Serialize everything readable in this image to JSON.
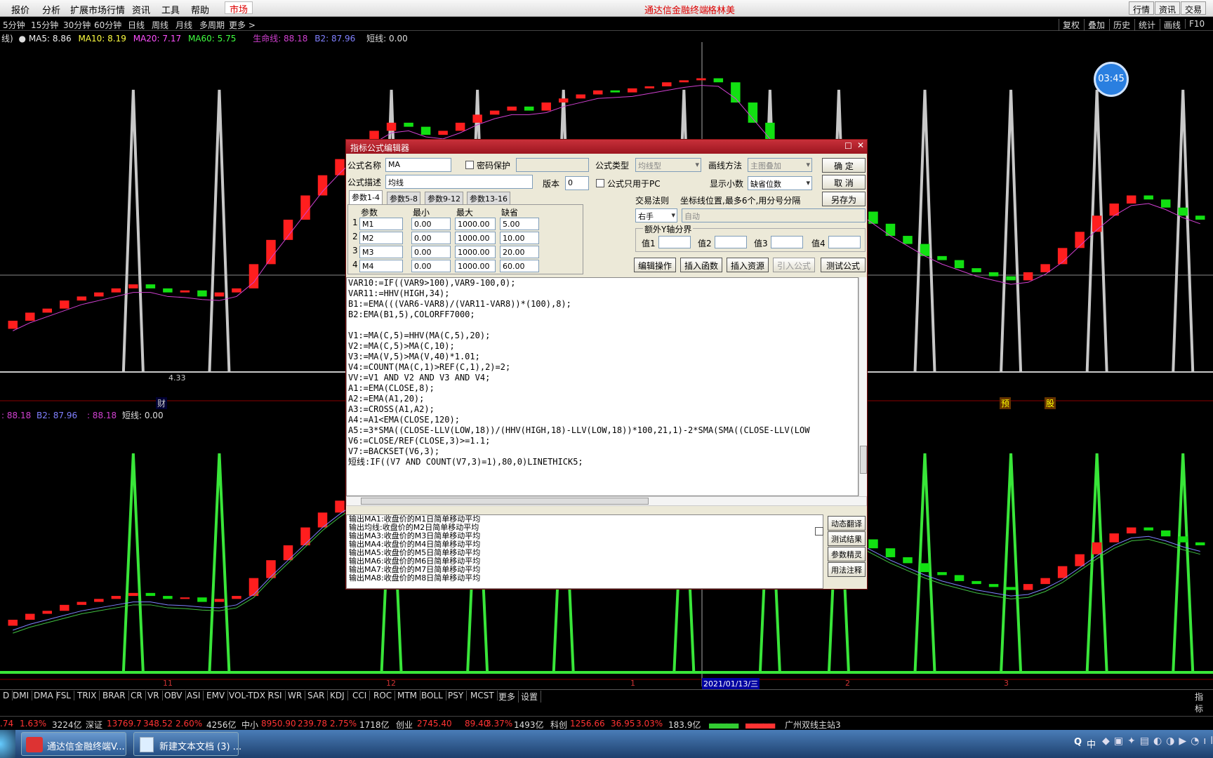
{
  "menu": {
    "items": [
      "报价",
      "分析",
      "扩展市场行情",
      "资讯",
      "工具",
      "帮助"
    ],
    "market_tab": "市场",
    "title": "通达信金融终端",
    "user": "格林美",
    "right_buttons": [
      "行情",
      "资讯",
      "交易"
    ]
  },
  "periods": {
    "items": [
      "5分钟",
      "15分钟",
      "30分钟",
      "60分钟",
      "日线",
      "周线",
      "月线",
      "多周期",
      "更多 >"
    ],
    "right": [
      "复权",
      "叠加",
      "历史",
      "统计",
      "画线",
      "F10"
    ]
  },
  "upper_legend": {
    "prefix": "线)",
    "ma5": "MA5: 8.86",
    "ma10": "MA10: 8.19",
    "ma20": "MA20: 7.17",
    "ma60": "MA60: 5.75",
    "life": "生命线: 88.18",
    "b2": "B2: 87.96",
    "short": "短线: 0.00"
  },
  "lower_legend": {
    "a": ": 88.18",
    "b2": "B2: 87.96",
    "c": ": 88.18",
    "short": "短线: 0.00"
  },
  "marks": {
    "cai": "财",
    "yu": "预",
    "gu": "股",
    "lowlabel": "4.33"
  },
  "timer": "03:45",
  "dialog": {
    "title": "指标公式编辑器",
    "name_label": "公式名称",
    "name_value": "MA",
    "password_label": "密码保护",
    "type_label": "公式类型",
    "type_value": "均线型",
    "draw_label": "画线方法",
    "draw_value": "主图叠加",
    "ok": "确 定",
    "cancel": "取 消",
    "saveas": "另存为",
    "desc_label": "公式描述",
    "desc_value": "均线",
    "version_label": "版本",
    "version_value": "0",
    "pc_only": "公式只用于PC",
    "decimals_label": "显示小数",
    "decimals_value": "缺省位数",
    "tabs": [
      "参数1-4",
      "参数5-8",
      "参数9-12",
      "参数13-16"
    ],
    "param_headers": [
      "参数",
      "最小",
      "最大",
      "缺省"
    ],
    "params": [
      {
        "n": "1",
        "name": "M1",
        "min": "0.00",
        "max": "1000.00",
        "def": "5.00"
      },
      {
        "n": "2",
        "name": "M2",
        "min": "0.00",
        "max": "1000.00",
        "def": "10.00"
      },
      {
        "n": "3",
        "name": "M3",
        "min": "0.00",
        "max": "1000.00",
        "def": "20.00"
      },
      {
        "n": "4",
        "name": "M4",
        "min": "0.00",
        "max": "1000.00",
        "def": "60.00"
      }
    ],
    "trade_label": "交易法则",
    "coord_label": "坐标线位置,最多6个,用分号分隔",
    "hand_value": "右手",
    "auto_value": "自动",
    "yaxis_label": "额外Y轴分界",
    "val_labels": [
      "值1",
      "值2",
      "值3",
      "值4"
    ],
    "action_buttons": [
      "编辑操作",
      "插入函数",
      "插入资源",
      "引入公式",
      "测试公式"
    ],
    "code_lines": [
      "VAR10:=IF((VAR9>100),VAR9-100,0);",
      "VAR11:=HHV(HIGH,34);",
      "B1:=EMA(((VAR6-VAR8)/(VAR11-VAR8))*(100),8);",
      "B2:EMA(B1,5),COLORFF7000;",
      "",
      "V1:=MA(C,5)=HHV(MA(C,5),20);",
      "V2:=MA(C,5)>MA(C,10);",
      "V3:=MA(V,5)>MA(V,40)*1.01;",
      "V4:=COUNT(MA(C,1)>REF(C,1),2)=2;",
      "VV:=V1 AND V2 AND V3 AND V4;",
      "A1:=EMA(CLOSE,8);",
      "A2:=EMA(A1,20);",
      "A3:=CROSS(A1,A2);",
      "A4:=A1<EMA(CLOSE,120);",
      "A5:=3*SMA((CLOSE-LLV(LOW,18))/(HHV(HIGH,18)-LLV(LOW,18))*100,21,1)-2*SMA(SMA((CLOSE-LLV(LOW",
      "V6:=CLOSE/REF(CLOSE,3)>=1.1;",
      "V7:=BACKSET(V6,3);",
      "短线:IF((V7 AND COUNT(V7,3)=1),80,0)LINETHICK5;"
    ],
    "messages": [
      "输出MA1:收盘价的M1日简单移动平均",
      "输出均线:收盘价的M2日简单移动平均",
      "输出MA3:收盘价的M3日简单移动平均",
      "输出MA4:收盘价的M4日简单移动平均",
      "输出MA5:收盘价的M5日简单移动平均",
      "输出MA6:收盘价的M6日简单移动平均",
      "输出MA7:收盘价的M7日简单移动平均",
      "输出MA8:收盘价的M8日简单移动平均"
    ],
    "side_buttons": [
      "动态翻译",
      "测试结果",
      "参数精灵",
      "用法注释"
    ]
  },
  "xaxis": {
    "l11": "11",
    "l12": "12",
    "l1": "1",
    "date": "2021/01/13/三",
    "l2": "2",
    "l3": "3"
  },
  "indicators": [
    "D",
    "DMI",
    "DMA",
    "FSL",
    "TRIX",
    "BRAR",
    "CR",
    "VR",
    "OBV",
    "ASI",
    "EMV",
    "VOL-TDX",
    "RSI",
    "WR",
    "SAR",
    "KDJ",
    "CCI",
    "ROC",
    "MTM",
    "BOLL",
    "PSY",
    "MCST",
    "更多",
    "设置"
  ],
  "indicator_right": "指标",
  "status": {
    "s0": ".74",
    "s0p": "1.63%",
    "s0v": "3224亿",
    "sz": "深证",
    "szv": "13769.7",
    "szc": "348.52",
    "szp": "2.60%",
    "szm": "4256亿",
    "zx": "中小",
    "zxv": "8950.90",
    "zxc": "239.78",
    "zxp": "2.75%",
    "zxm": "1718亿",
    "cy": "创业",
    "cyv": "2745.40",
    "cyc": "89.40",
    "cyp": "3.37%",
    "cym": "1493亿",
    "kc": "科创",
    "kcv": "1256.66",
    "kcc": "36.95",
    "kcp": "3.03%",
    "kcm": "183.9亿",
    "station": "广州双线主站3"
  },
  "taskbar": {
    "task1": "通达信金融终端V...",
    "task2": "新建文本文档 (3) ...",
    "ime": "中"
  },
  "colors": {
    "up": "#ff1e1e",
    "down": "#12e012",
    "life": "#d040d0",
    "b2": "#8080ff",
    "short": "#39e639",
    "spike": "#c8c8c8"
  },
  "chart_data": {
    "type": "candlestick",
    "note_values": "upper panel: price candles (open, close) with MA lines; lower panel: indicator lines 生命线, B2 and 短线 spikes (0 or 80)",
    "candles": [
      [
        6.2,
        6.4
      ],
      [
        6.4,
        6.6
      ],
      [
        6.6,
        6.7
      ],
      [
        6.7,
        6.9
      ],
      [
        6.9,
        7.0
      ],
      [
        7.0,
        7.1
      ],
      [
        7.1,
        7.2
      ],
      [
        7.2,
        7.3
      ],
      [
        7.3,
        7.2
      ],
      [
        7.2,
        7.1
      ],
      [
        7.1,
        7.15
      ],
      [
        7.15,
        7.0
      ],
      [
        7.0,
        7.1
      ],
      [
        7.1,
        7.2
      ],
      [
        7.2,
        7.8
      ],
      [
        7.8,
        8.4
      ],
      [
        8.4,
        8.9
      ],
      [
        8.9,
        9.5
      ],
      [
        9.5,
        10.0
      ],
      [
        10.0,
        10.4
      ],
      [
        10.4,
        10.8
      ],
      [
        10.8,
        11.1
      ],
      [
        11.1,
        11.3
      ],
      [
        11.3,
        11.2
      ],
      [
        11.2,
        11.0
      ],
      [
        11.0,
        11.1
      ],
      [
        11.1,
        11.3
      ],
      [
        11.3,
        11.5
      ],
      [
        11.5,
        11.6
      ],
      [
        11.6,
        11.7
      ],
      [
        11.7,
        11.6
      ],
      [
        11.6,
        11.8
      ],
      [
        11.8,
        11.9
      ],
      [
        11.9,
        12.0
      ],
      [
        12.0,
        12.1
      ],
      [
        12.1,
        12.05
      ],
      [
        12.05,
        12.15
      ],
      [
        12.15,
        12.2
      ],
      [
        12.2,
        12.3
      ],
      [
        12.3,
        12.35
      ],
      [
        12.35,
        12.4
      ],
      [
        12.4,
        12.3
      ],
      [
        12.3,
        11.8
      ],
      [
        11.8,
        11.3
      ],
      [
        11.3,
        10.8
      ],
      [
        10.8,
        10.4
      ],
      [
        10.4,
        10.0
      ],
      [
        10.0,
        9.7
      ],
      [
        9.7,
        9.4
      ],
      [
        9.4,
        9.1
      ],
      [
        9.1,
        8.8
      ],
      [
        8.8,
        8.5
      ],
      [
        8.5,
        8.3
      ],
      [
        8.3,
        8.0
      ],
      [
        8.0,
        7.9
      ],
      [
        7.9,
        7.7
      ],
      [
        7.7,
        7.6
      ],
      [
        7.6,
        7.5
      ],
      [
        7.5,
        7.4
      ],
      [
        7.4,
        7.6
      ],
      [
        7.6,
        7.8
      ],
      [
        7.8,
        8.2
      ],
      [
        8.2,
        8.6
      ],
      [
        8.6,
        9.0
      ],
      [
        9.0,
        9.3
      ],
      [
        9.3,
        9.5
      ],
      [
        9.5,
        9.4
      ],
      [
        9.4,
        9.2
      ],
      [
        9.2,
        9.0
      ],
      [
        9.0,
        8.9
      ]
    ],
    "short_spikes_at": [
      7,
      12,
      22,
      27,
      32,
      39,
      44,
      48,
      53,
      58,
      63,
      68
    ]
  }
}
